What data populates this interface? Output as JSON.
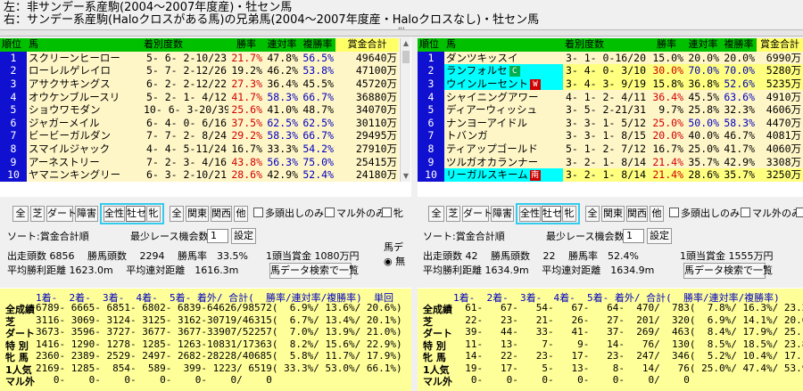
{
  "titles": {
    "left": "左：非サンデー系産駒(2004～2007年度産)・牡セン馬",
    "right": "右：サンデー系産駒(Haloクロスがある馬)の兄弟馬(2004～2007年度産・Haloクロスなし)・牡セン馬"
  },
  "splitter_glyph": "'''",
  "columns": [
    "順位",
    "馬",
    "着別度数",
    "勝率",
    "連対率",
    "複勝率",
    "賞金合計"
  ],
  "left": {
    "rows": [
      {
        "rank": "1",
        "name": "スクリーンヒーロー",
        "rec": "5- 6- 2-10/23",
        "win": "21.7%",
        "ren": "47.8%",
        "fuku": "56.5%",
        "money": "49640万",
        "sel": false
      },
      {
        "rank": "2",
        "name": "ローレルゲレイロ",
        "rec": "5- 7- 2-12/26",
        "win": "19.2%",
        "ren": "46.2%",
        "fuku": "53.8%",
        "money": "47100万",
        "sel": false
      },
      {
        "rank": "3",
        "name": "アサクサキングス",
        "rec": "6- 2- 2-12/22",
        "win": "27.3%",
        "ren": "36.4%",
        "fuku": "45.5%",
        "money": "45720万",
        "sel": false
      },
      {
        "rank": "4",
        "name": "オウケンブルースリ",
        "rec": "5- 2- 1- 4/12",
        "win": "41.7%",
        "ren": "58.3%",
        "fuku": "66.7%",
        "money": "36880万",
        "sel": false
      },
      {
        "rank": "5",
        "name": "ショウワモダン",
        "rec": "10- 6- 3-20/39",
        "win": "25.6%",
        "ren": "41.0%",
        "fuku": "48.7%",
        "money": "34070万",
        "sel": false
      },
      {
        "rank": "6",
        "name": "ジャガーメイル",
        "rec": "6- 4- 0- 6/16",
        "win": "37.5%",
        "ren": "62.5%",
        "fuku": "62.5%",
        "money": "30110万",
        "sel": false
      },
      {
        "rank": "7",
        "name": "ビービーガルダン",
        "rec": "7- 7- 2- 8/24",
        "win": "29.2%",
        "ren": "58.3%",
        "fuku": "66.7%",
        "money": "29495万",
        "sel": false
      },
      {
        "rank": "8",
        "name": "スマイルジャック",
        "rec": "4- 4- 5-11/24",
        "win": "16.7%",
        "ren": "33.3%",
        "fuku": "54.2%",
        "money": "27910万",
        "sel": false
      },
      {
        "rank": "9",
        "name": "アーネストリー",
        "rec": "7- 2- 3- 4/16",
        "win": "43.8%",
        "ren": "56.3%",
        "fuku": "75.0%",
        "money": "25415万",
        "sel": false
      },
      {
        "rank": "10",
        "name": "ヤマニンキングリー",
        "rec": "6- 3- 2-10/21",
        "win": "28.6%",
        "ren": "42.9%",
        "fuku": "52.4%",
        "money": "24180万",
        "sel": false
      }
    ],
    "buttons1": [
      "全",
      "芝",
      "ダート",
      "障害"
    ],
    "buttons2": [
      "全性",
      "牡セン",
      "牝"
    ],
    "buttons3": [
      "全",
      "関東",
      "関西",
      "他"
    ],
    "checks": [
      "多頭出しのみ",
      "マル外のみ",
      "牝"
    ],
    "sort_label": "ソート:賞金合計順",
    "min_label": "最少レース機会数",
    "min_value": "1",
    "set_button": "設定",
    "stat_line1": "出走頭数 6856　 勝馬頭数　 2294　 勝馬率　33.5%",
    "stat_line2": "平均勝利距離 1623.0m　 平均連対距離　1616.3m",
    "prize_label": "1頭当賞金 1080万円",
    "search_button": "馬データ検索で一覧",
    "side_label": "馬デ",
    "side_radio": "◉ 無",
    "stats_header": "1着-  2着-  3着-  4着-  5着- 着外/ 合計(  勝率/連対率/複勝率)  単回",
    "stats_rows": [
      {
        "label": "全成績",
        "value": "6789- 6665- 6851- 6802- 6839-64626/98572(  6.9%/ 13.6%/ 20.6%)  7"
      },
      {
        "label": "芝",
        "value": "3116- 3069- 3124- 3125- 3162-30719/46315(  6.7%/ 13.4%/ 20.1%)  7"
      },
      {
        "label": "ダート",
        "value": "3673- 3596- 3727- 3677- 3677-33907/52257(  7.0%/ 13.9%/ 21.0%)  7"
      },
      {
        "label": "特 別",
        "value": "1416- 1290- 1278- 1285- 1263-10831/17363(  8.2%/ 15.6%/ 22.9%)  8"
      },
      {
        "label": "牝 馬",
        "value": "2360- 2389- 2529- 2497- 2682-28228/40685(  5.8%/ 11.7%/ 17.9%)  6"
      },
      {
        "label": "1人気",
        "value": "2169- 1285-  854-  589-  399- 1223/ 6519( 33.3%/ 53.0%/ 66.1%)  7"
      },
      {
        "label": "マル外",
        "value": "   0-    0-    0-    0-    0-    0/    0"
      }
    ]
  },
  "right": {
    "rows": [
      {
        "rank": "1",
        "name": "ダンツキッスイ",
        "rec": "3- 1- 0-16/20",
        "win": "15.0%",
        "ren": "20.0%",
        "fuku": "20.0%",
        "money": "6990万",
        "sel": false,
        "tag": ""
      },
      {
        "rank": "2",
        "name": "ランフォルセ",
        "rec": "3- 4- 0- 3/10",
        "win": "30.0%",
        "ren": "70.0%",
        "fuku": "70.0%",
        "money": "5280万",
        "sel": true,
        "tag": "C"
      },
      {
        "rank": "3",
        "name": "ウインルーセント",
        "rec": "3- 4- 3- 9/19",
        "win": "15.8%",
        "ren": "36.8%",
        "fuku": "52.6%",
        "money": "5235万",
        "sel": true,
        "tag": "W"
      },
      {
        "rank": "4",
        "name": "シャイニングアワー",
        "rec": "4- 1- 2- 4/11",
        "win": "36.4%",
        "ren": "45.5%",
        "fuku": "63.6%",
        "money": "4910万",
        "sel": false,
        "tag": ""
      },
      {
        "rank": "5",
        "name": "ディアーウィッシュ",
        "rec": "3- 5- 2-21/31",
        "win": "9.7%",
        "ren": "25.8%",
        "fuku": "32.3%",
        "money": "4606万",
        "sel": false,
        "tag": ""
      },
      {
        "rank": "6",
        "name": "ナンヨーアイドル",
        "rec": "3- 3- 1- 5/12",
        "win": "25.0%",
        "ren": "50.0%",
        "fuku": "58.3%",
        "money": "4470万",
        "sel": false,
        "tag": ""
      },
      {
        "rank": "7",
        "name": "トバンガ",
        "rec": "3- 3- 1- 8/15",
        "win": "20.0%",
        "ren": "40.0%",
        "fuku": "46.7%",
        "money": "4081万",
        "sel": false,
        "tag": ""
      },
      {
        "rank": "8",
        "name": "ティアップゴールド",
        "rec": "5- 1- 2- 7/12",
        "win": "16.7%",
        "ren": "25.0%",
        "fuku": "41.7%",
        "money": "4060万",
        "sel": false,
        "tag": ""
      },
      {
        "rank": "9",
        "name": "ツルガオカランナー",
        "rec": "3- 2- 1- 8/14",
        "win": "21.4%",
        "ren": "35.7%",
        "fuku": "42.9%",
        "money": "3308万",
        "sel": false,
        "tag": ""
      },
      {
        "rank": "10",
        "name": "リーガルスキーム",
        "rec": "3- 2- 1- 8/14",
        "win": "21.4%",
        "ren": "28.6%",
        "fuku": "35.7%",
        "money": "3250万",
        "sel": true,
        "tag": "南"
      }
    ],
    "buttons1": [
      "全",
      "芝",
      "ダート",
      "障害"
    ],
    "buttons2": [
      "全性",
      "牡セン",
      "牝"
    ],
    "buttons3": [
      "全",
      "関東",
      "関西",
      "他"
    ],
    "checks": [
      "多頭出しのみ",
      "マル外のみ",
      "牝"
    ],
    "sort_label": "ソート:賞金合計順",
    "min_label": "最少レース機会数",
    "min_value": "1",
    "set_button": "設定",
    "stat_line1": "出走頭数 42　 勝馬頭数　 22　 勝馬率　52.4%",
    "stat_line2": "平均勝利距離 1634.9m　 平均連対距離　1634.9m",
    "prize_label": "1頭当賞金 1555万円",
    "search_button": "馬データ検索で一覧",
    "stats_header": "1着-  2着-  3着-  4着-  5着- 着外/ 合計(  勝率/連対率/複勝率)",
    "stats_rows": [
      {
        "label": "全成績",
        "value": "  61-   67-   54-   67-   64-  470/  783(  7.8%/ 16.3%/ 23.2%)"
      },
      {
        "label": "芝",
        "value": "  22-   23-   21-   26-   27-  201/  320(  6.9%/ 14.1%/ 20.6%)"
      },
      {
        "label": "ダート",
        "value": "  39-   44-   33-   41-   37-  269/  463(  8.4%/ 17.9%/ 25.1%)"
      },
      {
        "label": "特 別",
        "value": "  11-   13-    7-    9-   14-   76/  130(  8.5%/ 18.5%/ 23.8%)"
      },
      {
        "label": "牝 馬",
        "value": "  14-   22-   23-   17-   23-  247/  346(  5.2%/ 10.4%/ 17.1%)"
      },
      {
        "label": "1人気",
        "value": "  19-   17-    5-   13-    8-   14/   76( 25.0%/ 47.4%/ 53.9%)"
      },
      {
        "label": "マル外",
        "value": "   0-    0-    0-    0-    0-    0/    0"
      }
    ]
  },
  "colors": {
    "header": "#00c000",
    "rank_bg": "#1010d0",
    "row_bg": "#fff6c8",
    "selected": "#00ffff",
    "stats_bg": "#ffff99",
    "accent_red": "#d00000",
    "accent_blue": "#0000c0"
  }
}
